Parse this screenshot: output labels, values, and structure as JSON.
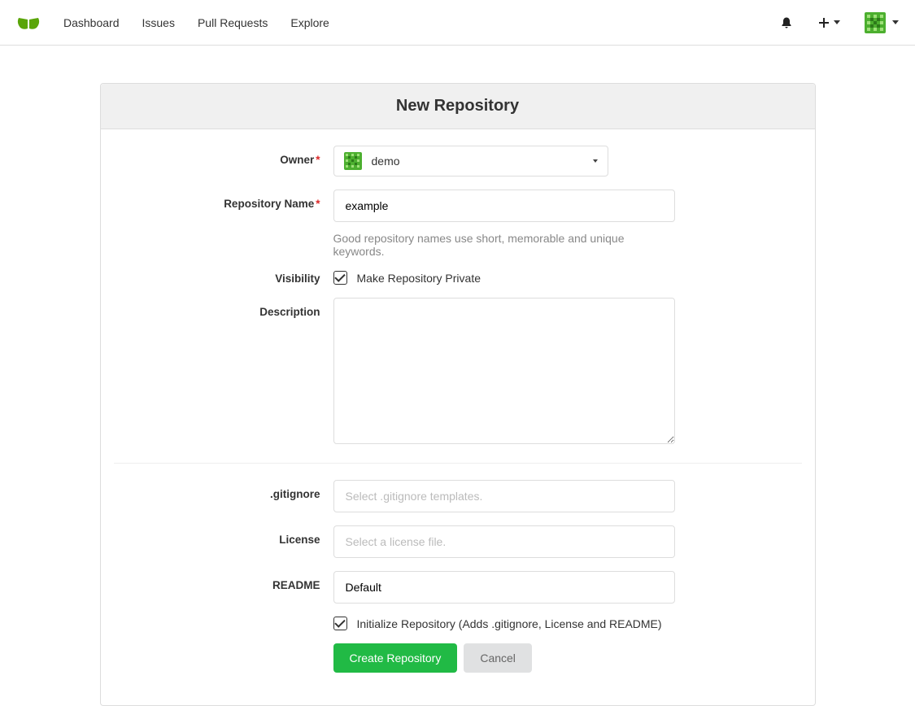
{
  "nav": {
    "dashboard": "Dashboard",
    "issues": "Issues",
    "pullRequests": "Pull Requests",
    "explore": "Explore"
  },
  "page": {
    "title": "New Repository"
  },
  "form": {
    "owner": {
      "label": "Owner",
      "value": "demo"
    },
    "repoName": {
      "label": "Repository Name",
      "value": "example",
      "hint": "Good repository names use short, memorable and unique keywords."
    },
    "visibility": {
      "label": "Visibility",
      "checkboxLabel": "Make Repository Private",
      "checked": true
    },
    "description": {
      "label": "Description",
      "value": ""
    },
    "gitignore": {
      "label": ".gitignore",
      "placeholder": "Select .gitignore templates."
    },
    "license": {
      "label": "License",
      "placeholder": "Select a license file."
    },
    "readme": {
      "label": "README",
      "value": "Default"
    },
    "initRepo": {
      "label": "Initialize Repository (Adds .gitignore, License and README)",
      "checked": true
    },
    "submit": "Create Repository",
    "cancel": "Cancel"
  }
}
